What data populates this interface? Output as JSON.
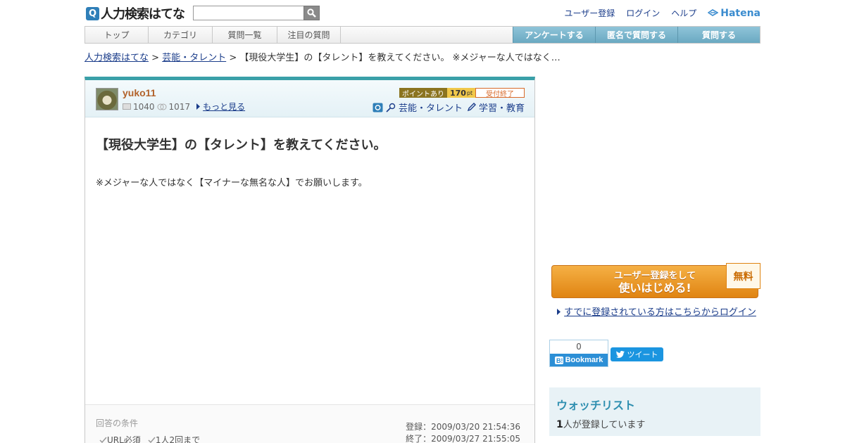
{
  "header": {
    "logo_text": "人力検索はてな",
    "logo_letter": "Q",
    "links": [
      "ユーザー登録",
      "ログイン",
      "ヘルプ"
    ],
    "hatena_label": "Hatena"
  },
  "nav": {
    "left": [
      "トップ",
      "カテゴリ",
      "質問一覧",
      "注目の質問"
    ],
    "right": [
      "アンケートする",
      "匿名で質問する",
      "質問する"
    ]
  },
  "breadcrumb": {
    "home": "人力検索はてな",
    "sep1": " > ",
    "category": "芸能・タレント",
    "sep2": " > ",
    "current": "【現役大学生】の【タレント】を教えてください。 ※メジャーな人ではなく…"
  },
  "question": {
    "username": "yuko11",
    "stat_questions": "1040",
    "stat_answers": "1017",
    "more_link": "もっと見る",
    "point_label": "ポイントあり",
    "point_value": "170",
    "point_unit": "pt",
    "status": "受付終了",
    "category1": "芸能・タレント",
    "category2": "学習・教育",
    "title": "【現役大学生】の【タレント】を教えてください。",
    "body": "※メジャーな人ではなく【マイナーな無名な人】でお願いします。",
    "conditions_label": "回答の条件",
    "conditions": [
      "URL必須",
      "1人2回まで"
    ],
    "registered": "登録：2009/03/20 21:54:36",
    "ended": "終了：2009/03/27 21:55:05"
  },
  "sidebar": {
    "signup_line1": "ユーザー登録をして",
    "signup_line2": "使いはじめる!",
    "free_tag": "無料",
    "login_link": "すでに登録されている方はこちらからログイン",
    "bookmark_count": "0",
    "bookmark_label": "Bookmark",
    "tweet_label": "ツイート",
    "watchlist_title": "ウォッチリスト",
    "watchlist_count": "1",
    "watchlist_suffix": "人が登録しています"
  },
  "colors": {
    "accent_teal": "#3aa0a8",
    "link": "#1a3c8a",
    "username": "#b2622a",
    "signup_orange": "#e08412"
  }
}
